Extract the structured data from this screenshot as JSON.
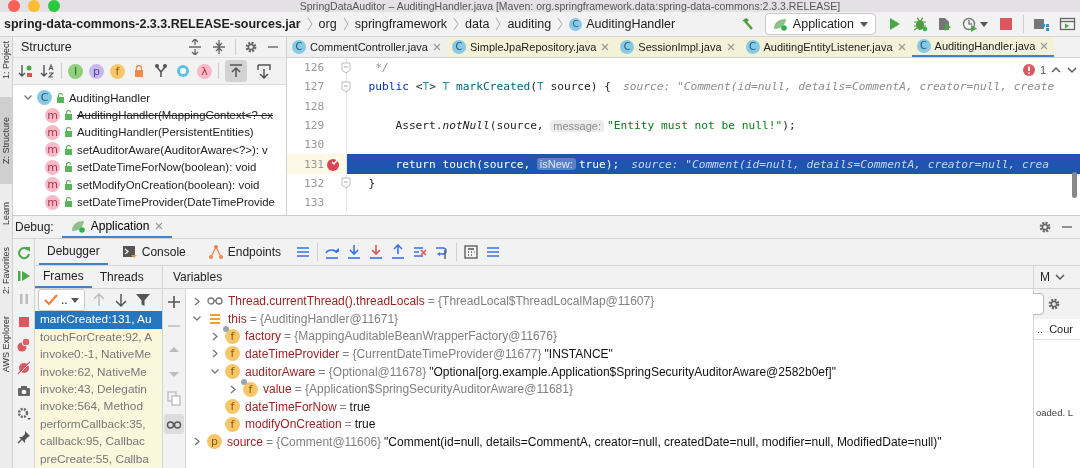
{
  "window": {
    "title": "SpringDataAuditor – AuditingHandler.java [Maven: org.springframework.data:spring-data-commons:2.3.3.RELEASE]"
  },
  "navbar": {
    "breadcrumbs": [
      {
        "label": "spring-data-commons-2.3.3.RELEASE-sources.jar",
        "kind": "jar"
      },
      {
        "label": "org",
        "kind": "package"
      },
      {
        "label": "springframework",
        "kind": "package"
      },
      {
        "label": "data",
        "kind": "package"
      },
      {
        "label": "auditing",
        "kind": "package"
      },
      {
        "label": "AuditingHandler",
        "kind": "class",
        "badge": "C"
      }
    ],
    "run_config": "Application"
  },
  "side_stripe": [
    {
      "label": "1: Project",
      "selected": false
    },
    {
      "label": "Z: Structure",
      "selected": true
    },
    {
      "label": "Learn",
      "selected": false
    },
    {
      "label": "2: Favorites",
      "selected": false
    },
    {
      "label": "AWS Explorer",
      "selected": false
    }
  ],
  "structure": {
    "title": "Structure",
    "filters": [
      {
        "kind": "interface",
        "badge": "I"
      },
      {
        "kind": "property",
        "badge": "p"
      },
      {
        "kind": "field",
        "badge": "f"
      },
      {
        "kind": "lock"
      },
      {
        "kind": "hierarchy"
      },
      {
        "kind": "anonymous"
      },
      {
        "kind": "lambda",
        "badge": "λ"
      }
    ],
    "toggles": [
      {
        "kind": "scroll-to",
        "selected": true
      },
      {
        "kind": "scroll-from",
        "selected": false
      }
    ],
    "tree": [
      {
        "label": "AuditingHandler",
        "kind": "class",
        "badge": "C",
        "expanded": true,
        "children": [
          {
            "label": "AuditingHandler(MappingContext<? ex",
            "kind": "method",
            "badge": "m",
            "deprecated": true
          },
          {
            "label": "AuditingHandler(PersistentEntities)",
            "kind": "method",
            "badge": "m",
            "deprecated": false
          },
          {
            "label": "setAuditorAware(AuditorAware<?>): v",
            "kind": "method",
            "badge": "m",
            "deprecated": false
          },
          {
            "label": "setDateTimeForNow(boolean): void",
            "kind": "method",
            "badge": "m",
            "deprecated": false
          },
          {
            "label": "setModifyOnCreation(boolean): void",
            "kind": "method",
            "badge": "m",
            "deprecated": false
          },
          {
            "label": "setDateTimeProvider(DateTimeProvide",
            "kind": "method",
            "badge": "m",
            "deprecated": false
          }
        ]
      }
    ]
  },
  "editor": {
    "tabs": [
      {
        "label": "CommentController.java",
        "badge": "C",
        "library": false,
        "selected": false
      },
      {
        "label": "SimpleJpaRepository.java",
        "badge": "C",
        "library": true,
        "selected": false
      },
      {
        "label": "SessionImpl.java",
        "badge": "C",
        "library": true,
        "selected": false
      },
      {
        "label": "AuditingEntityListener.java",
        "badge": "C",
        "library": true,
        "selected": false
      },
      {
        "label": "AuditingHandler.java",
        "badge": "C",
        "library": true,
        "selected": true
      }
    ],
    "problems": "1",
    "lines": [
      {
        "number": "126",
        "current": false,
        "breakpoint": false,
        "fold": true,
        "segments": [
          {
            "kind": "comment",
            "text": "   */"
          }
        ]
      },
      {
        "number": "127",
        "current": false,
        "breakpoint": false,
        "fold": true,
        "segments": [
          {
            "kind": "kw",
            "text": "  public "
          },
          {
            "kind": "plain",
            "text": "<"
          },
          {
            "kind": "type",
            "text": "T"
          },
          {
            "kind": "plain",
            "text": "> "
          },
          {
            "kind": "type",
            "text": "T "
          },
          {
            "kind": "method",
            "text": "markCreated"
          },
          {
            "kind": "plain",
            "text": "("
          },
          {
            "kind": "type",
            "text": "T"
          },
          {
            "kind": "plain",
            "text": " source) {"
          },
          {
            "kind": "value",
            "text": "source: \"Comment(id=null, details=CommentA, creator=null, create"
          }
        ]
      },
      {
        "number": "128",
        "current": false,
        "breakpoint": false,
        "fold": false
      },
      {
        "number": "129",
        "current": false,
        "breakpoint": false,
        "fold": false,
        "segments": [
          {
            "kind": "plain",
            "text": "      Assert."
          },
          {
            "kind": "italic",
            "text": "notNull"
          },
          {
            "kind": "plain",
            "text": "(source, "
          },
          {
            "kind": "hint",
            "text": "message:"
          },
          {
            "kind": "str",
            "text": "\"Entity must not be null!\""
          },
          {
            "kind": "plain",
            "text": ");"
          }
        ]
      },
      {
        "number": "130",
        "current": false,
        "breakpoint": false,
        "fold": false
      },
      {
        "number": "131",
        "current": true,
        "breakpoint": true,
        "fold": false,
        "segments": [
          {
            "kind": "kw",
            "text": "      return "
          },
          {
            "kind": "plain",
            "text": "touch(source, "
          },
          {
            "kind": "hint",
            "text": "isNew:"
          },
          {
            "kind": "plain",
            "text": "true);"
          },
          {
            "kind": "value",
            "text": "source: \"Comment(id=null, details=CommentA, creator=null, crea"
          }
        ]
      },
      {
        "number": "132",
        "current": false,
        "breakpoint": false,
        "fold": true,
        "segments": [
          {
            "kind": "plain",
            "text": "  }"
          }
        ]
      },
      {
        "number": "133",
        "current": false,
        "breakpoint": false,
        "fold": false
      }
    ]
  },
  "debug": {
    "title": "Debug:",
    "session": "Application",
    "tabs": [
      {
        "label": "Debugger",
        "kind": "debugger",
        "selected": true
      },
      {
        "label": "Console",
        "kind": "console",
        "selected": false
      },
      {
        "label": "Endpoints",
        "kind": "endpoints",
        "selected": false
      }
    ],
    "frame_tabs": [
      {
        "label": "Frames",
        "selected": true
      },
      {
        "label": "Threads",
        "selected": false
      }
    ],
    "thread_filter": "..",
    "frames": [
      {
        "label": "markCreated:131, Au",
        "selected": true
      },
      {
        "label": "touchForCreate:92, A",
        "selected": false
      },
      {
        "label": "invoke0:-1, NativeMe",
        "selected": false
      },
      {
        "label": "invoke:62, NativeMe",
        "selected": false
      },
      {
        "label": "invoke:43, Delegatin",
        "selected": false
      },
      {
        "label": "invoke:564, Method",
        "selected": false
      },
      {
        "label": "performCallback:35,",
        "selected": false
      },
      {
        "label": "callback:95, Callbac",
        "selected": false
      },
      {
        "label": "preCreate:55, Callba",
        "selected": false
      }
    ],
    "variables_title": "Variables",
    "variables": [
      {
        "name": "Thread.currentThread().threadLocals",
        "kind": "watch",
        "value": "= {ThreadLocal$ThreadLocalMap@11607}",
        "expanded": false
      },
      {
        "name": "this",
        "kind": "object",
        "value": "= {AuditingHandler@11671}",
        "expanded": true,
        "children": [
          {
            "name": "factory",
            "kind": "field",
            "badge": "f",
            "final": true,
            "value": "= {MappingAuditableBeanWrapperFactory@11676}",
            "expanded": false
          },
          {
            "name": "dateTimeProvider",
            "kind": "field",
            "badge": "f",
            "final": false,
            "value": "= {CurrentDateTimeProvider@11677}",
            "text": "\"INSTANCE\"",
            "expanded": false
          },
          {
            "name": "auditorAware",
            "kind": "field",
            "badge": "f",
            "final": false,
            "value": "= {Optional@11678}",
            "text": "\"Optional[org.example.Application$SpringSecurityAuditorAware@2582b0ef]\"",
            "expanded": true,
            "children": [
              {
                "name": "value",
                "kind": "field",
                "badge": "f",
                "final": true,
                "value": "= {Application$SpringSecurityAuditorAware@11681}",
                "expanded": false
              }
            ]
          },
          {
            "name": "dateTimeForNow",
            "kind": "field",
            "badge": "f",
            "final": false,
            "value": "=",
            "text": "true"
          },
          {
            "name": "modifyOnCreation",
            "kind": "field",
            "badge": "f",
            "final": false,
            "value": "=",
            "text": "true"
          }
        ]
      },
      {
        "name": "source",
        "kind": "param",
        "badge": "p",
        "value": "= {Comment@11606}",
        "text": "\"Comment(id=null, details=CommentA, creator=null, createdDate=null, modifier=null, ModifiedDate=null)\"",
        "expanded": false
      }
    ],
    "side_panel": {
      "tab": "M",
      "column": "Cour",
      "cell": "..",
      "message": "oaded. L"
    }
  }
}
